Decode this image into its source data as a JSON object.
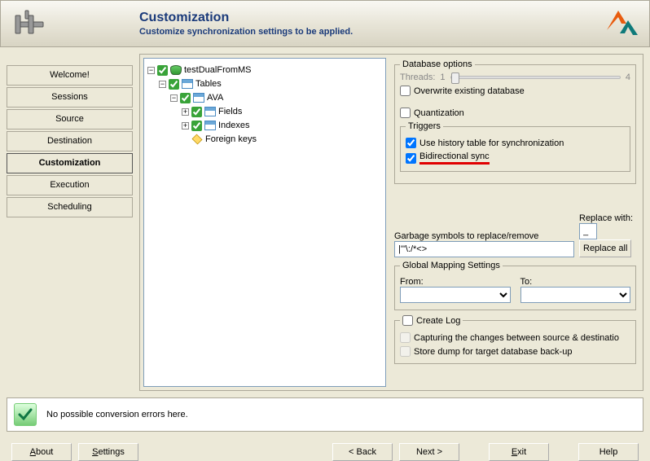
{
  "header": {
    "title": "Customization",
    "subtitle": "Customize synchronization settings to be applied."
  },
  "nav": {
    "items": [
      "Welcome!",
      "Sessions",
      "Source",
      "Destination",
      "Customization",
      "Execution",
      "Scheduling"
    ],
    "active": "Customization"
  },
  "tree": {
    "root": "testDualFromMS",
    "tables": "Tables",
    "table1": "AVA",
    "fields": "Fields",
    "indexes": "Indexes",
    "fkeys": "Foreign keys"
  },
  "options": {
    "db_legend": "Database options",
    "threads_label": "Threads:",
    "threads_min": "1",
    "threads_max": "4",
    "overwrite": "Overwrite existing database",
    "quantization": "Quantization",
    "triggers_legend": "Triggers",
    "use_history": "Use history table for synchronization",
    "bidirectional": "Bidirectional sync",
    "garbage_label": "Garbage symbols to replace/remove",
    "garbage_value": "|'\"\\:/*<>",
    "replace_label": "Replace with:",
    "replace_value": "_",
    "replace_all_btn": "Replace all",
    "mapping_legend": "Global Mapping Settings",
    "from_label": "From:",
    "to_label": "To:",
    "log_legend": "Create Log",
    "capturing": "Capturing the changes between source & destinatio",
    "store_dump": "Store dump for target database back-up"
  },
  "status": {
    "text": "No possible conversion errors here."
  },
  "footer": {
    "about": "About",
    "settings": "Settings",
    "back": "< Back",
    "next": "Next >",
    "exit": "Exit",
    "help": "Help"
  }
}
